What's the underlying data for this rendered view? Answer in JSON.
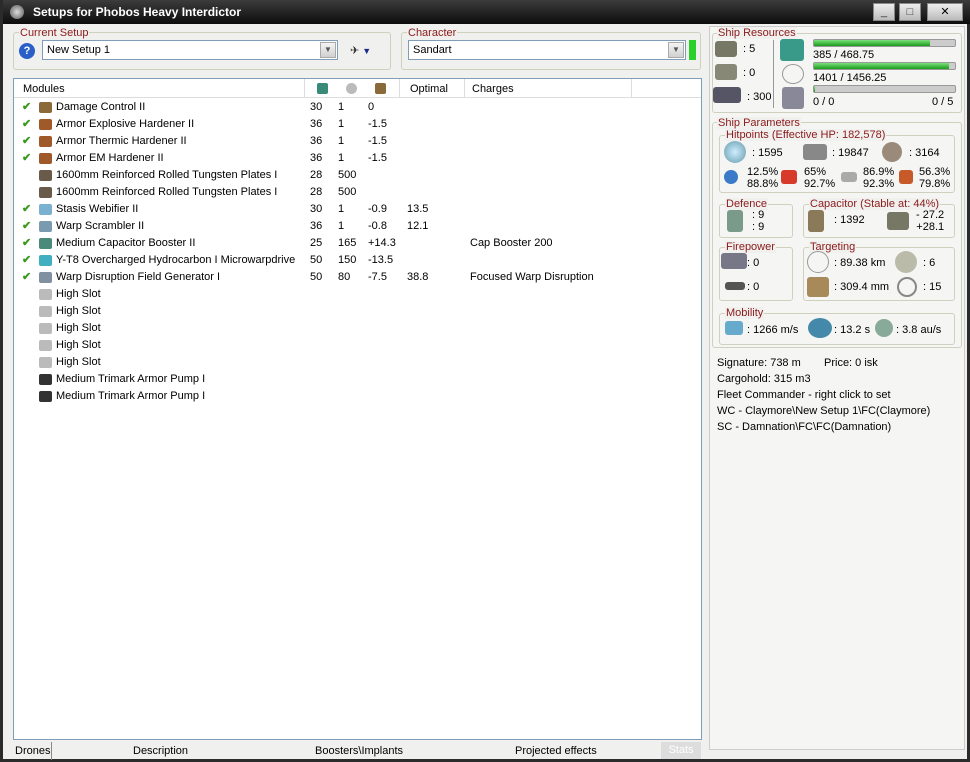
{
  "window": {
    "title": "Setups for Phobos Heavy Interdictor",
    "minimize": "_",
    "maximize": "□",
    "close": "✕"
  },
  "current_setup": {
    "label": "Current Setup",
    "value": "New Setup 1"
  },
  "character": {
    "label": "Character",
    "value": "Sandart"
  },
  "modules": {
    "headers": [
      "Modules",
      "",
      "",
      "",
      "Optimal",
      "Charges"
    ],
    "rows": [
      {
        "active": true,
        "name": "Damage Control II",
        "c1": "30",
        "c2": "1",
        "c3": "0",
        "optimal": "",
        "charges": "",
        "color": "#8a6a3a"
      },
      {
        "active": true,
        "name": "Armor Explosive Hardener II",
        "c1": "36",
        "c2": "1",
        "c3": "-1.5",
        "optimal": "",
        "charges": "",
        "color": "#a05a2a"
      },
      {
        "active": true,
        "name": "Armor Thermic Hardener II",
        "c1": "36",
        "c2": "1",
        "c3": "-1.5",
        "optimal": "",
        "charges": "",
        "color": "#a05a2a"
      },
      {
        "active": true,
        "name": "Armor EM Hardener II",
        "c1": "36",
        "c2": "1",
        "c3": "-1.5",
        "optimal": "",
        "charges": "",
        "color": "#a05a2a"
      },
      {
        "active": false,
        "name": "1600mm Reinforced Rolled Tungsten Plates I",
        "c1": "28",
        "c2": "500",
        "c3": "",
        "optimal": "",
        "charges": "",
        "color": "#6a5a4a"
      },
      {
        "active": false,
        "name": "1600mm Reinforced Rolled Tungsten Plates I",
        "c1": "28",
        "c2": "500",
        "c3": "",
        "optimal": "",
        "charges": "",
        "color": "#6a5a4a"
      },
      {
        "active": true,
        "name": "Stasis Webifier II",
        "c1": "30",
        "c2": "1",
        "c3": "-0.9",
        "optimal": "13.5",
        "charges": "",
        "color": "#7ab0d0"
      },
      {
        "active": true,
        "name": "Warp Scrambler II",
        "c1": "36",
        "c2": "1",
        "c3": "-0.8",
        "optimal": "12.1",
        "charges": "",
        "color": "#7a9ab0"
      },
      {
        "active": true,
        "name": "Medium Capacitor Booster II",
        "c1": "25",
        "c2": "165",
        "c3": "+14.3",
        "optimal": "",
        "charges": "Cap Booster 200",
        "color": "#4a8a7a"
      },
      {
        "active": true,
        "name": "Y-T8 Overcharged Hydrocarbon I Microwarpdrive",
        "c1": "50",
        "c2": "150",
        "c3": "-13.5",
        "optimal": "",
        "charges": "",
        "color": "#40b0c0"
      },
      {
        "active": true,
        "name": "Warp Disruption Field Generator I",
        "c1": "50",
        "c2": "80",
        "c3": "-7.5",
        "optimal": "38.8",
        "charges": "Focused Warp Disruption",
        "color": "#8090a0"
      },
      {
        "active": false,
        "name": "High Slot",
        "c1": "",
        "c2": "",
        "c3": "",
        "optimal": "",
        "charges": "",
        "color": "#bbbbbb"
      },
      {
        "active": false,
        "name": "High Slot",
        "c1": "",
        "c2": "",
        "c3": "",
        "optimal": "",
        "charges": "",
        "color": "#bbbbbb"
      },
      {
        "active": false,
        "name": "High Slot",
        "c1": "",
        "c2": "",
        "c3": "",
        "optimal": "",
        "charges": "",
        "color": "#bbbbbb"
      },
      {
        "active": false,
        "name": "High Slot",
        "c1": "",
        "c2": "",
        "c3": "",
        "optimal": "",
        "charges": "",
        "color": "#bbbbbb"
      },
      {
        "active": false,
        "name": "High Slot",
        "c1": "",
        "c2": "",
        "c3": "",
        "optimal": "",
        "charges": "",
        "color": "#bbbbbb"
      },
      {
        "active": false,
        "name": "Medium Trimark Armor Pump I",
        "c1": "",
        "c2": "",
        "c3": "",
        "optimal": "",
        "charges": "",
        "color": "#333333"
      },
      {
        "active": false,
        "name": "Medium Trimark Armor Pump I",
        "c1": "",
        "c2": "",
        "c3": "",
        "optimal": "",
        "charges": "",
        "color": "#333333"
      }
    ]
  },
  "tabs": [
    "Drones",
    "Description",
    "Boosters\\Implants",
    "Projected effects",
    "Stats"
  ],
  "resources": {
    "label": "Ship Resources",
    "turrets": ": 5",
    "launchers": ": 0",
    "calibration": ": 300",
    "cpu": "385 / 468.75",
    "cpu_frac": 0.82,
    "power": "1401 / 1456.25",
    "power_frac": 0.96,
    "drone_bw": "0 / 0",
    "drone_bw_frac": 0,
    "drones": "0 / 5"
  },
  "params": {
    "label": "Ship Parameters",
    "hp_label": "Hitpoints (Effective HP: 182,578)",
    "shield": ": 1595",
    "armor": ": 19847",
    "hull": ": 3164",
    "res": [
      [
        "12.5%",
        "88.8%"
      ],
      [
        "65%",
        "92.7%"
      ],
      [
        "86.9%",
        "92.3%"
      ],
      [
        "56.3%",
        "79.8%"
      ]
    ],
    "defence_label": "Defence",
    "def1": ": 9",
    "def2": ": 9",
    "cap_label": "Capacitor (Stable at: 44%)",
    "cap": ": 1392",
    "cap_use": "- 27.2",
    "cap_regen": "+28.1",
    "fire_label": "Firepower",
    "fire1": ": 0",
    "fire2": ": 0",
    "target_label": "Targeting",
    "range": ": 89.38 km",
    "targets": ": 6",
    "scanres": ": 309.4 mm",
    "sensor": ": 15",
    "mob_label": "Mobility",
    "speed": ": 1266 m/s",
    "align": ": 13.2 s",
    "warp": ": 3.8 au/s"
  },
  "info": {
    "signature": "Signature: 738 m",
    "price": "Price: 0 isk",
    "cargo": "Cargohold: 315 m3",
    "fc": "Fleet Commander - right click to set",
    "wc": "WC - Claymore\\New Setup 1\\FC(Claymore)",
    "sc": "SC - Damnation\\FC\\FC(Damnation)"
  }
}
